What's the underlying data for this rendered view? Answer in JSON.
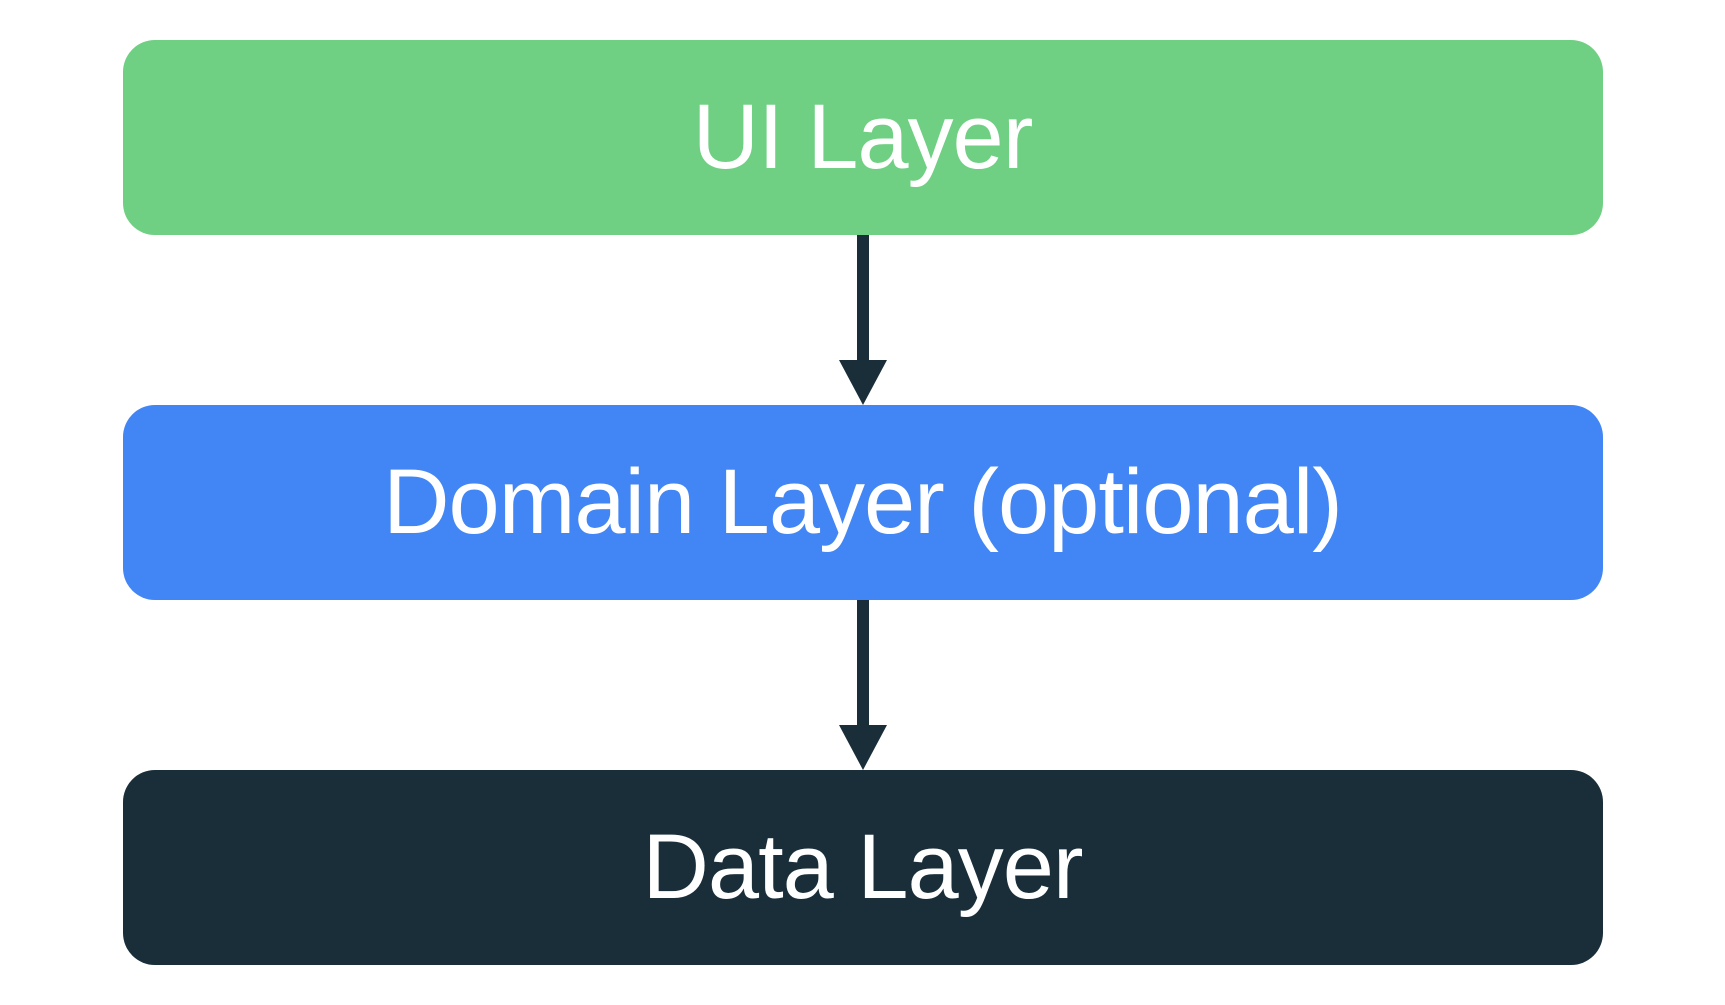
{
  "layers": {
    "ui": {
      "label": "UI Layer",
      "color": "#6fcf82"
    },
    "domain": {
      "label": "Domain Layer (optional)",
      "color": "#4285f4"
    },
    "data": {
      "label": "Data Layer",
      "color": "#1a2e3a"
    }
  },
  "arrow_color": "#1a2e3a"
}
